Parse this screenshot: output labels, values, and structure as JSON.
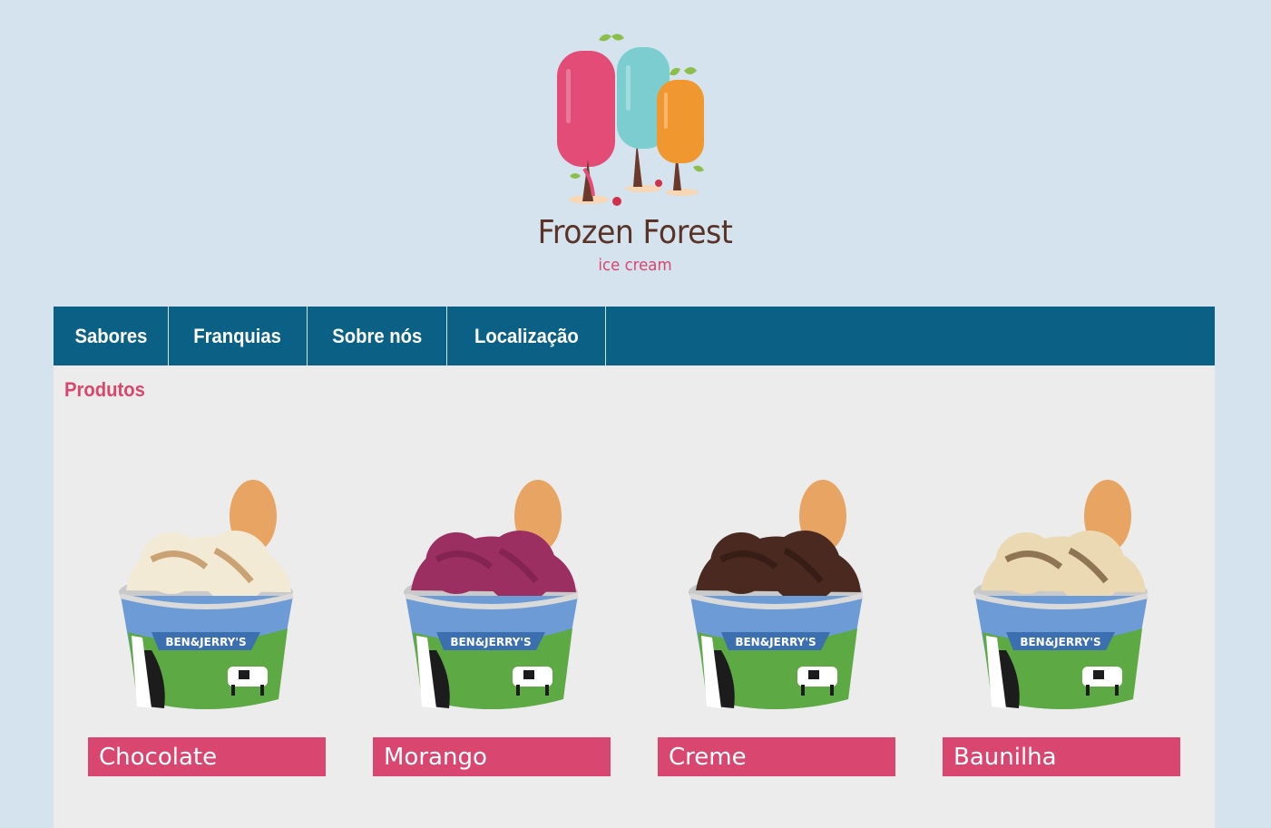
{
  "brand": {
    "name": "Frozen Forest",
    "tagline": "ice cream",
    "colors": {
      "pink": "#e24c77",
      "teal": "#7ccdd0",
      "orange": "#f1972f",
      "brown": "#5a3328"
    }
  },
  "nav": {
    "items": [
      {
        "label": "Sabores"
      },
      {
        "label": "Franquias"
      },
      {
        "label": "Sobre nós"
      },
      {
        "label": "Localização"
      }
    ],
    "background": "#0b6185"
  },
  "main": {
    "section_title": "Produtos",
    "products": [
      {
        "label": "Chocolate",
        "scoop_color": "#f3ead6",
        "swirl_color": "#b9834a"
      },
      {
        "label": "Morango",
        "scoop_color": "#9c2f62",
        "swirl_color": "#7a1f4b"
      },
      {
        "label": "Creme",
        "scoop_color": "#4a2a20",
        "swirl_color": "#2e1812"
      },
      {
        "label": "Baunilha",
        "scoop_color": "#ead9b3",
        "swirl_color": "#6a4a2e"
      }
    ],
    "cup_brand": "BEN&JERRY'S",
    "accent": "#d9466f"
  }
}
